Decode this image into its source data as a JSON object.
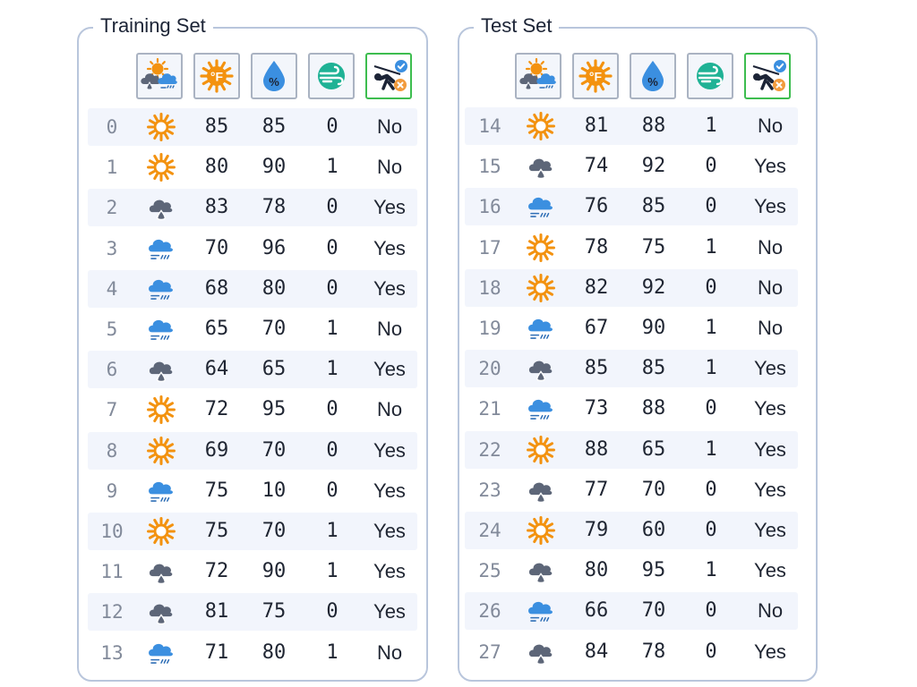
{
  "colors": {
    "panel_border": "#b9c6dc",
    "row_alt_bg": "#f2f5fc",
    "sunny": "#f3920f",
    "rainy": "#5d6678",
    "overcast_cloud": "#3b8fe0",
    "target_border": "#3dbd4f"
  },
  "header_icons": [
    "outlook-icon",
    "temperature-fahrenheit-icon",
    "humidity-percent-icon",
    "windy-icon",
    "play-decision-icon"
  ],
  "panels": [
    {
      "title": "Training Set",
      "rows": [
        {
          "index": "0",
          "outlook": "sunny",
          "temperature": "85",
          "humidity": "85",
          "windy": "0",
          "play": "No"
        },
        {
          "index": "1",
          "outlook": "sunny",
          "temperature": "80",
          "humidity": "90",
          "windy": "1",
          "play": "No"
        },
        {
          "index": "2",
          "outlook": "rainy",
          "temperature": "83",
          "humidity": "78",
          "windy": "0",
          "play": "Yes"
        },
        {
          "index": "3",
          "outlook": "overcast",
          "temperature": "70",
          "humidity": "96",
          "windy": "0",
          "play": "Yes"
        },
        {
          "index": "4",
          "outlook": "overcast",
          "temperature": "68",
          "humidity": "80",
          "windy": "0",
          "play": "Yes"
        },
        {
          "index": "5",
          "outlook": "overcast",
          "temperature": "65",
          "humidity": "70",
          "windy": "1",
          "play": "No"
        },
        {
          "index": "6",
          "outlook": "rainy",
          "temperature": "64",
          "humidity": "65",
          "windy": "1",
          "play": "Yes"
        },
        {
          "index": "7",
          "outlook": "sunny",
          "temperature": "72",
          "humidity": "95",
          "windy": "0",
          "play": "No"
        },
        {
          "index": "8",
          "outlook": "sunny",
          "temperature": "69",
          "humidity": "70",
          "windy": "0",
          "play": "Yes"
        },
        {
          "index": "9",
          "outlook": "overcast",
          "temperature": "75",
          "humidity": "10",
          "windy": "0",
          "play": "Yes"
        },
        {
          "index": "10",
          "outlook": "sunny",
          "temperature": "75",
          "humidity": "70",
          "windy": "1",
          "play": "Yes"
        },
        {
          "index": "11",
          "outlook": "rainy",
          "temperature": "72",
          "humidity": "90",
          "windy": "1",
          "play": "Yes"
        },
        {
          "index": "12",
          "outlook": "rainy",
          "temperature": "81",
          "humidity": "75",
          "windy": "0",
          "play": "Yes"
        },
        {
          "index": "13",
          "outlook": "overcast",
          "temperature": "71",
          "humidity": "80",
          "windy": "1",
          "play": "No"
        }
      ]
    },
    {
      "title": "Test Set",
      "rows": [
        {
          "index": "14",
          "outlook": "sunny",
          "temperature": "81",
          "humidity": "88",
          "windy": "1",
          "play": "No"
        },
        {
          "index": "15",
          "outlook": "rainy",
          "temperature": "74",
          "humidity": "92",
          "windy": "0",
          "play": "Yes"
        },
        {
          "index": "16",
          "outlook": "overcast",
          "temperature": "76",
          "humidity": "85",
          "windy": "0",
          "play": "Yes"
        },
        {
          "index": "17",
          "outlook": "sunny",
          "temperature": "78",
          "humidity": "75",
          "windy": "1",
          "play": "No"
        },
        {
          "index": "18",
          "outlook": "sunny",
          "temperature": "82",
          "humidity": "92",
          "windy": "0",
          "play": "No"
        },
        {
          "index": "19",
          "outlook": "overcast",
          "temperature": "67",
          "humidity": "90",
          "windy": "1",
          "play": "No"
        },
        {
          "index": "20",
          "outlook": "rainy",
          "temperature": "85",
          "humidity": "85",
          "windy": "1",
          "play": "Yes"
        },
        {
          "index": "21",
          "outlook": "overcast",
          "temperature": "73",
          "humidity": "88",
          "windy": "0",
          "play": "Yes"
        },
        {
          "index": "22",
          "outlook": "sunny",
          "temperature": "88",
          "humidity": "65",
          "windy": "1",
          "play": "Yes"
        },
        {
          "index": "23",
          "outlook": "rainy",
          "temperature": "77",
          "humidity": "70",
          "windy": "0",
          "play": "Yes"
        },
        {
          "index": "24",
          "outlook": "sunny",
          "temperature": "79",
          "humidity": "60",
          "windy": "0",
          "play": "Yes"
        },
        {
          "index": "25",
          "outlook": "rainy",
          "temperature": "80",
          "humidity": "95",
          "windy": "1",
          "play": "Yes"
        },
        {
          "index": "26",
          "outlook": "overcast",
          "temperature": "66",
          "humidity": "70",
          "windy": "0",
          "play": "No"
        },
        {
          "index": "27",
          "outlook": "rainy",
          "temperature": "84",
          "humidity": "78",
          "windy": "0",
          "play": "Yes"
        }
      ]
    }
  ]
}
